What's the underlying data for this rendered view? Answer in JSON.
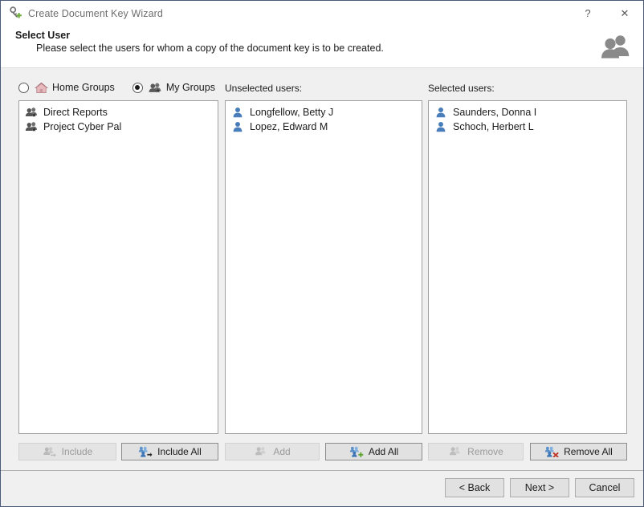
{
  "window": {
    "title": "Create Document Key Wizard",
    "title_icon": "user-key-add-icon",
    "help_button": "?",
    "close_button": "✕"
  },
  "header": {
    "title": "Select User",
    "subtitle": "Please select the users for whom a copy of the document key is to be created.",
    "icon": "people-group-icon"
  },
  "scope": {
    "options": [
      {
        "label": "Home Groups",
        "icon": "home-icon",
        "selected": false
      },
      {
        "label": "My Groups",
        "icon": "my-groups-icon",
        "selected": true
      }
    ]
  },
  "columns": {
    "groups_label": "",
    "unselected_label": "Unselected users:",
    "selected_label": "Selected users:"
  },
  "groups_list": {
    "items": [
      {
        "label": "Direct Reports",
        "icon": "group-star-icon"
      },
      {
        "label": "Project Cyber Pal",
        "icon": "group-star-icon"
      }
    ]
  },
  "unselected_users": {
    "items": [
      {
        "label": "Longfellow, Betty J",
        "icon": "user-icon"
      },
      {
        "label": "Lopez, Edward M",
        "icon": "user-icon"
      }
    ]
  },
  "selected_users": {
    "items": [
      {
        "label": "Saunders, Donna I",
        "icon": "user-icon"
      },
      {
        "label": "Schoch, Herbert L",
        "icon": "user-icon"
      }
    ]
  },
  "actions": {
    "include": {
      "label": "Include",
      "enabled": false,
      "icon": "include-icon"
    },
    "include_all": {
      "label": "Include All",
      "enabled": true,
      "icon": "include-all-icon"
    },
    "add": {
      "label": "Add",
      "enabled": false,
      "icon": "add-icon"
    },
    "add_all": {
      "label": "Add All",
      "enabled": true,
      "icon": "add-all-icon"
    },
    "remove": {
      "label": "Remove",
      "enabled": false,
      "icon": "remove-icon"
    },
    "remove_all": {
      "label": "Remove All",
      "enabled": true,
      "icon": "remove-all-icon"
    }
  },
  "footer": {
    "back": "< Back",
    "next": "Next >",
    "cancel": "Cancel"
  },
  "colors": {
    "accent_blue": "#3f7bbf",
    "user_icon_blue": "#4a7ebb",
    "green_plus": "#5da52e",
    "red_x": "#c0392b",
    "title_text": "#6e6e6e",
    "window_bg": "#f0f0f0",
    "list_bg": "#ffffff"
  }
}
